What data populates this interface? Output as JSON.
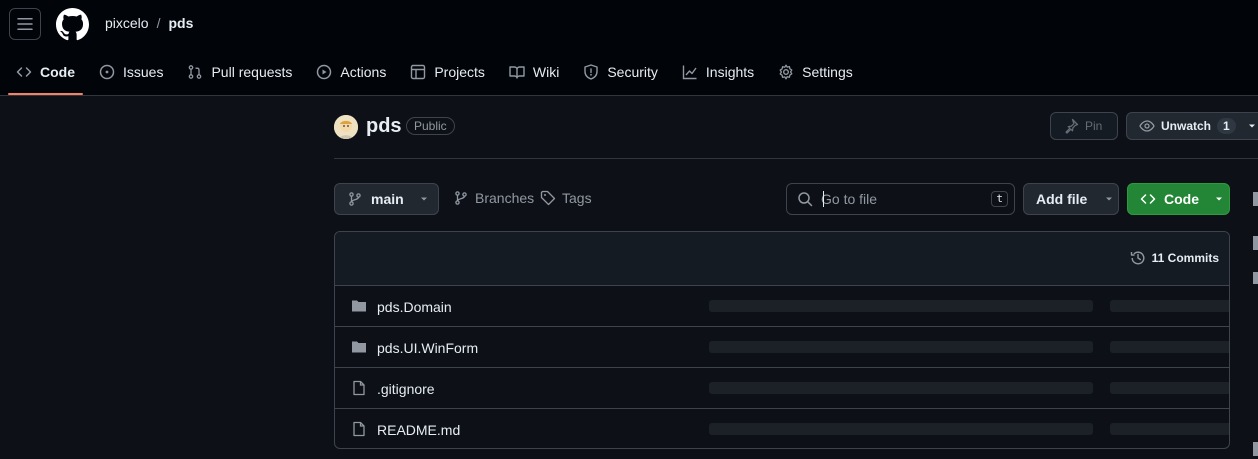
{
  "header": {
    "owner": "pixcelo",
    "separator": "/",
    "repo": "pds"
  },
  "nav": [
    {
      "label": "Code",
      "icon": "code-icon",
      "active": true
    },
    {
      "label": "Issues",
      "icon": "issue-icon"
    },
    {
      "label": "Pull requests",
      "icon": "pull-request-icon"
    },
    {
      "label": "Actions",
      "icon": "play-icon"
    },
    {
      "label": "Projects",
      "icon": "table-icon"
    },
    {
      "label": "Wiki",
      "icon": "book-icon"
    },
    {
      "label": "Security",
      "icon": "shield-icon"
    },
    {
      "label": "Insights",
      "icon": "graph-icon"
    },
    {
      "label": "Settings",
      "icon": "gear-icon"
    }
  ],
  "repo_head": {
    "title": "pds",
    "visibility": "Public",
    "pin_label": "Pin",
    "unwatch_label": "Unwatch",
    "watch_count": "1"
  },
  "toolbar": {
    "branch": "main",
    "branches_label": "Branches",
    "tags_label": "Tags",
    "search_placeholder": "Go to file",
    "search_shortcut": "t",
    "add_file_label": "Add file",
    "code_label": "Code"
  },
  "files": {
    "commits_label": "11 Commits",
    "rows": [
      {
        "name": "pds.Domain",
        "type": "folder"
      },
      {
        "name": "pds.UI.WinForm",
        "type": "folder"
      },
      {
        "name": ".gitignore",
        "type": "file"
      },
      {
        "name": "README.md",
        "type": "file"
      }
    ]
  },
  "colors": {
    "accent_underline": "#f78166",
    "code_button": "#238636",
    "background": "#0d1117",
    "header_background": "#010409"
  }
}
